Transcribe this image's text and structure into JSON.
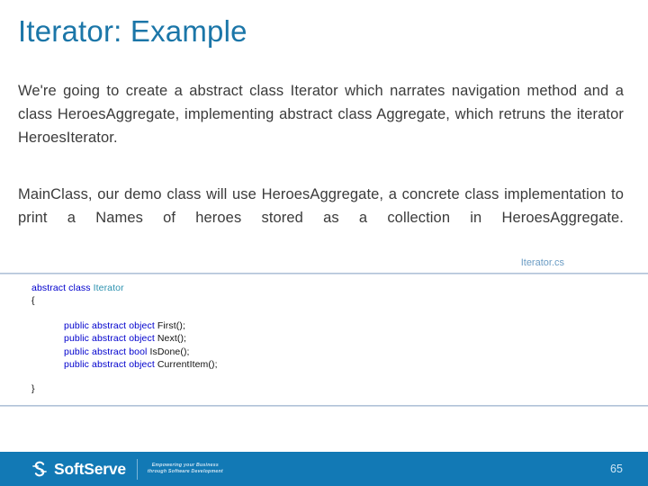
{
  "slide": {
    "title": "Iterator: Example",
    "title_color": "#1b76a8",
    "paragraphs": [
      "We're going to create a abstract class Iterator which narrates navigation method and a class HeroesAggregate, implementing abstract class Aggregate, which retruns the iterator HeroesIterator.",
      "MainClass, our demo class will use HeroesAggregate, a concrete class implementation to print a Names of heroes stored as a collection in HeroesAggregate."
    ]
  },
  "code": {
    "caption": "Iterator.cs",
    "caption_color": "#6b9cc4",
    "keyword_color": "#0000cd",
    "type_color": "#2b91af",
    "lines": [
      {
        "indent": 0,
        "kw": "abstract class ",
        "type": "Iterator",
        "plain": ""
      },
      {
        "indent": 0,
        "kw": "",
        "type": "",
        "plain": "{"
      },
      {
        "indent": 1,
        "kw": "public abstract object ",
        "type": "",
        "plain": "First();"
      },
      {
        "indent": 1,
        "kw": "public abstract object ",
        "type": "",
        "plain": "Next();"
      },
      {
        "indent": 1,
        "kw": "public abstract bool ",
        "type": "",
        "plain": "IsDone();"
      },
      {
        "indent": 1,
        "kw": "public abstract object ",
        "type": "",
        "plain": "CurrentItem();"
      },
      {
        "indent": 0,
        "kw": "",
        "type": "",
        "plain": "}"
      }
    ]
  },
  "footer": {
    "bar_color": "#1279b5",
    "logo_name": "SoftServe",
    "tagline_line1": "Empowering your Business",
    "tagline_line2": "through Software Development",
    "page_number": "65"
  }
}
